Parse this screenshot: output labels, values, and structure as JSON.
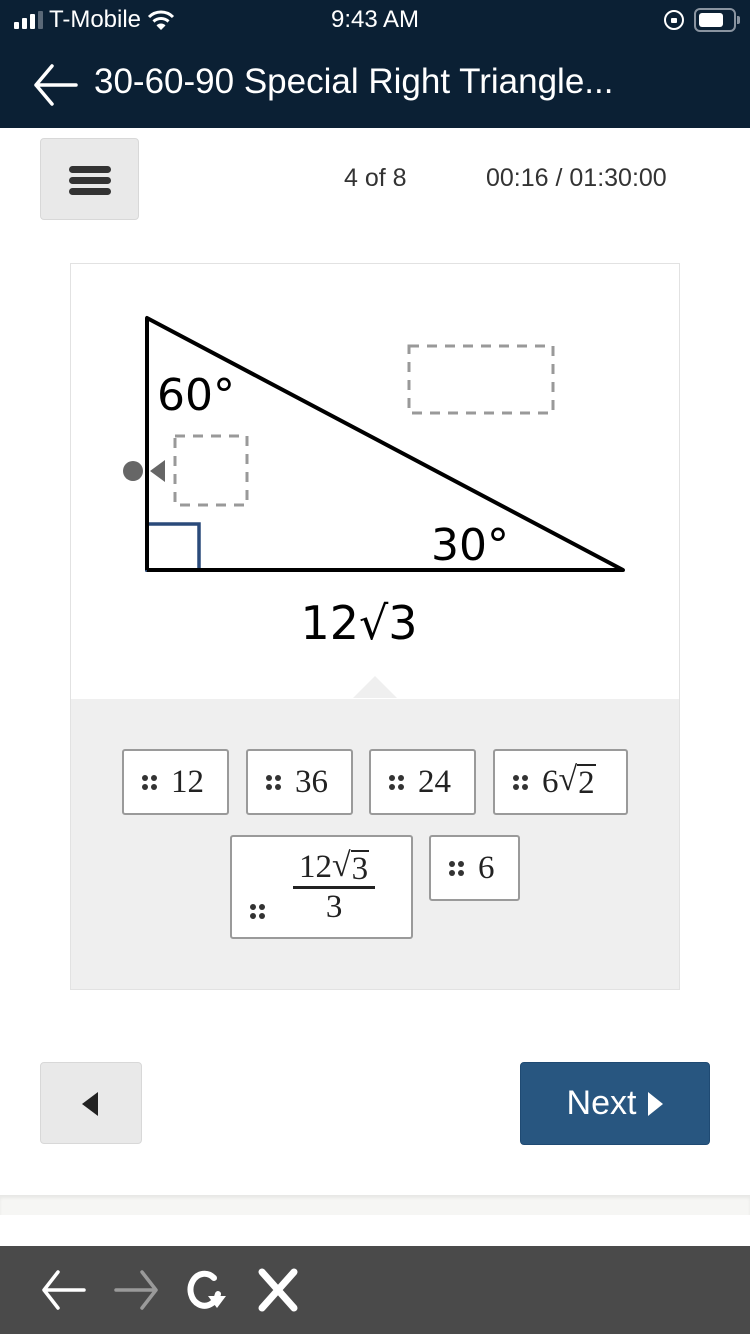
{
  "status_bar": {
    "carrier": "T-Mobile",
    "time": "9:43 AM"
  },
  "nav": {
    "title": "30-60-90 Special Right Triangle..."
  },
  "toolbar": {
    "question_counter": "4 of 8",
    "timer": "00:16 / 01:30:00"
  },
  "diagram": {
    "angle_top": "60°",
    "angle_right": "30°",
    "side_bottom_label": "12√3",
    "drop_zones": [
      "hypotenuse-drop-zone",
      "left-leg-drop-zone"
    ],
    "right_angle_color": "#2a4a7a"
  },
  "answer_choices": [
    {
      "id": "12",
      "whole": "12"
    },
    {
      "id": "36",
      "whole": "36"
    },
    {
      "id": "24",
      "whole": "24"
    },
    {
      "id": "6root2",
      "coef": "6",
      "radicand": "2"
    },
    {
      "id": "12root3over3",
      "num_coef": "12",
      "num_radicand": "3",
      "den": "3"
    },
    {
      "id": "6",
      "whole": "6"
    }
  ],
  "footer": {
    "next_label": "Next"
  },
  "colors": {
    "header_bg": "#0b2034",
    "next_bg": "#285680",
    "tray_bg": "#efefef",
    "browser_bar_bg": "#4a4a4a"
  }
}
